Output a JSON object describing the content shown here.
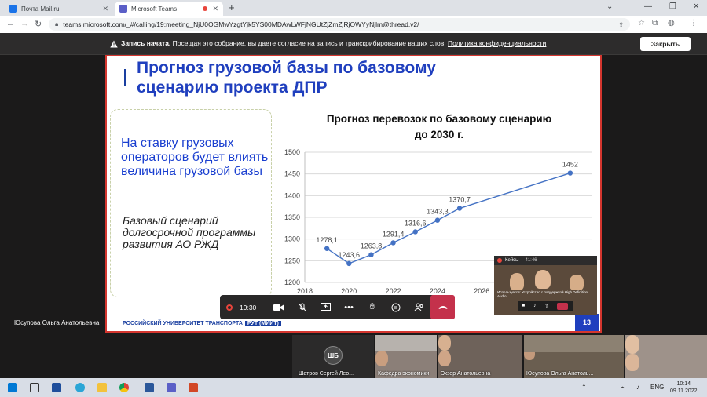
{
  "browser": {
    "tabs": [
      {
        "title": "Почта Mail.ru",
        "active": false
      },
      {
        "title": "Microsoft Teams",
        "active": true
      }
    ],
    "new_tab": "+",
    "url": "teams.microsoft.com/_#/calling/19:meeting_NjU0OGMwYzgtYjk5YS00MDAwLWFjNGUtZjZmZjRjOWYyNjlm@thread.v2/"
  },
  "banner": {
    "bold": "Запись начата.",
    "text": " Посещая это собрание, вы даете согласие на запись и транскрибирование ваших слов. ",
    "link": "Политика конфиденциальности",
    "close_label": "Закрыть"
  },
  "slide": {
    "title": "Прогноз грузовой базы по базовому сценарию проекта ДПР",
    "lead": "На ставку грузовых операторов будет влиять величина грузовой базы",
    "italic": "Базовый сценарий долгосрочной программы развития АО РЖД",
    "footer": "РОССИЙСКИЙ УНИВЕРСИТЕТ ТРАНСПОРТА",
    "footer_tag": "РУТ (МИИТ)",
    "page_number": "13"
  },
  "chart_data": {
    "type": "line",
    "title": "Прогноз перевозок по базовому сценарию до 2030 г.",
    "title_lines": [
      "Прогноз перевозок по базовому сценарию",
      "до 2030 г."
    ],
    "xlabel": "",
    "ylabel": "",
    "x": [
      2019,
      2020,
      2021,
      2022,
      2023,
      2024,
      2025,
      2030
    ],
    "values": [
      1278.1,
      1243.6,
      1263.8,
      1291.4,
      1316.6,
      1343.3,
      1370.7,
      1452
    ],
    "labels": [
      "1278,1",
      "1243,6",
      "1263,8",
      "1291,4",
      "1316,6",
      "1343,3",
      "1370,7",
      "1452"
    ],
    "xlim": [
      2018,
      2031
    ],
    "ylim": [
      1200,
      1500
    ],
    "xticks": [
      2018,
      2020,
      2022,
      2024,
      2026
    ],
    "yticks": [
      1200,
      1250,
      1300,
      1350,
      1400,
      1450,
      1500
    ],
    "grid": true,
    "color": "#4472c4"
  },
  "meeting": {
    "presenter": "Юсупова Ольга Анатольевна",
    "timer": "19:30",
    "mini": {
      "title": "Кейсы",
      "time": "41:46",
      "caption": "Используется: Устройство с поддержкой High Definition Audio"
    },
    "gallery": [
      {
        "initials": "ШБ",
        "name": "Шатров Сергей Лео..."
      },
      {
        "name": "Кафедра экономики"
      },
      {
        "name": "Экзер Анатольевна"
      },
      {
        "name": "Юсупова Ольга Анатоль..."
      },
      {
        "name": ""
      }
    ]
  },
  "taskbar": {
    "language": "ENG",
    "time": "10:14",
    "date": "09.11.2022"
  }
}
